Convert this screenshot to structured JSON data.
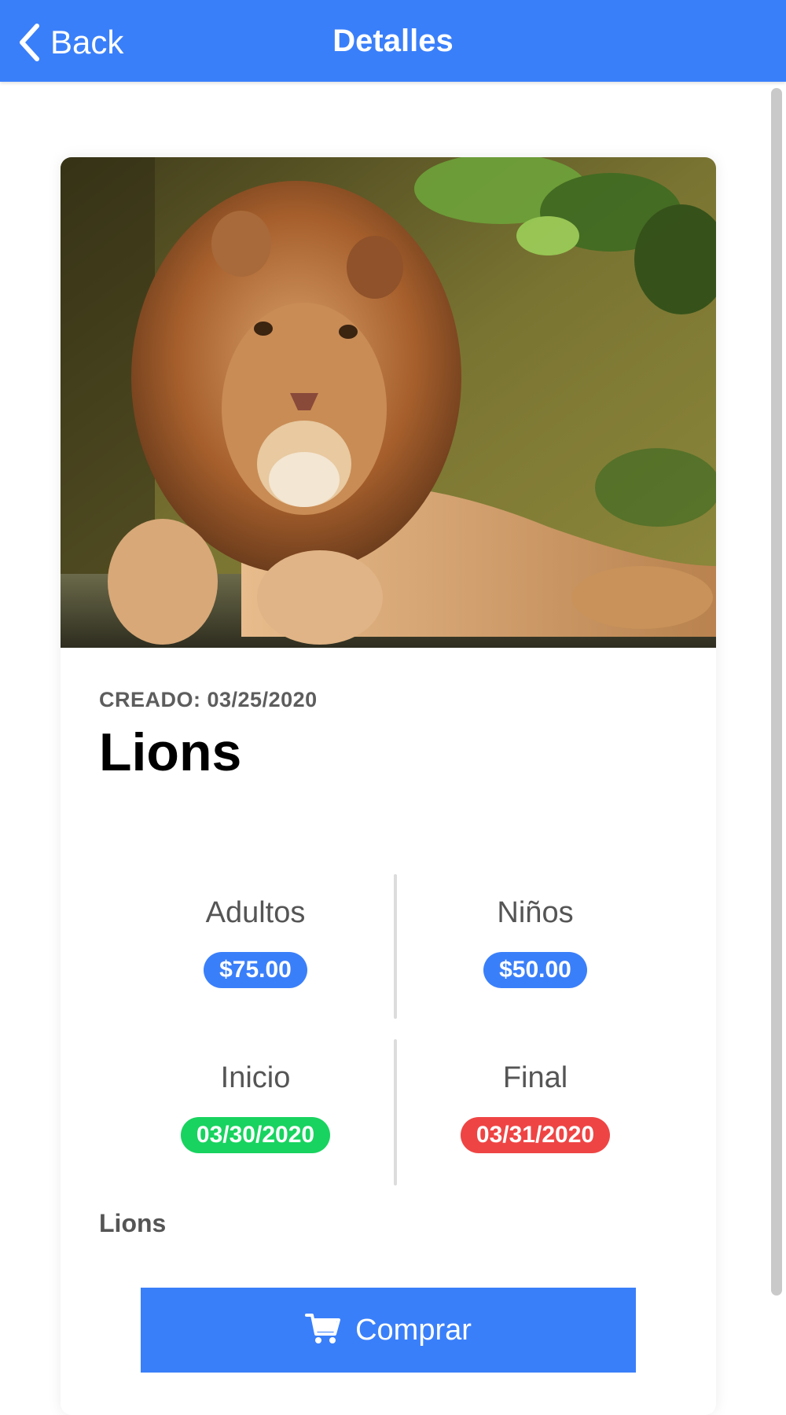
{
  "header": {
    "back_label": "Back",
    "title": "Detalles"
  },
  "detail": {
    "image_subject": "lion resting on a log",
    "created": "CREADO: 03/25/2020",
    "title": "Lions",
    "description": "Lions"
  },
  "prices": {
    "adults_label": "Adultos",
    "adults_value": "$75.00",
    "kids_label": "Niños",
    "kids_value": "$50.00"
  },
  "dates": {
    "start_label": "Inicio",
    "start_value": "03/30/2020",
    "end_label": "Final",
    "end_value": "03/31/2020"
  },
  "actions": {
    "buy_label": "Comprar"
  },
  "icons": {
    "back": "chevron-left-icon",
    "buy": "cart-icon"
  },
  "colors": {
    "primary": "#3a7ffa",
    "start_badge": "#18d35f",
    "end_badge": "#ef4444",
    "label_text": "#555555"
  }
}
